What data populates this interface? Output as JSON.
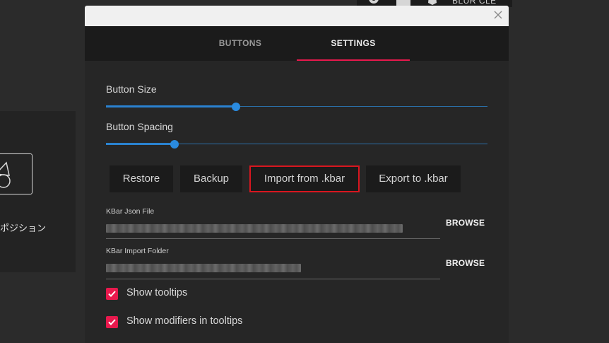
{
  "background": {
    "left_label": "ポジション",
    "top_text": "BLUR  CLE",
    "icons": [
      "shape-tool-icon",
      "gear-icon",
      "bell-icon"
    ]
  },
  "dialog": {
    "close_icon": "close-icon",
    "tabs": [
      {
        "label": "BUTTONS",
        "active": false
      },
      {
        "label": "SETTINGS",
        "active": true
      }
    ],
    "accent_color": "#e8194d",
    "slider_color": "#2a8be0",
    "sliders": [
      {
        "label": "Button Size",
        "value": 0.34
      },
      {
        "label": "Button Spacing",
        "value": 0.18
      }
    ],
    "buttons": [
      {
        "label": "Restore"
      },
      {
        "label": "Backup"
      },
      {
        "label": "Import from .kbar",
        "highlighted": true
      },
      {
        "label": "Export to .kbar"
      }
    ],
    "fields": [
      {
        "label": "KBar Json File",
        "browse_label": "BROWSE"
      },
      {
        "label": "KBar Import Folder",
        "browse_label": "BROWSE"
      }
    ],
    "checkboxes": [
      {
        "label": "Show tooltips",
        "checked": true
      },
      {
        "label": "Show modifiers in tooltips",
        "checked": true
      }
    ]
  }
}
